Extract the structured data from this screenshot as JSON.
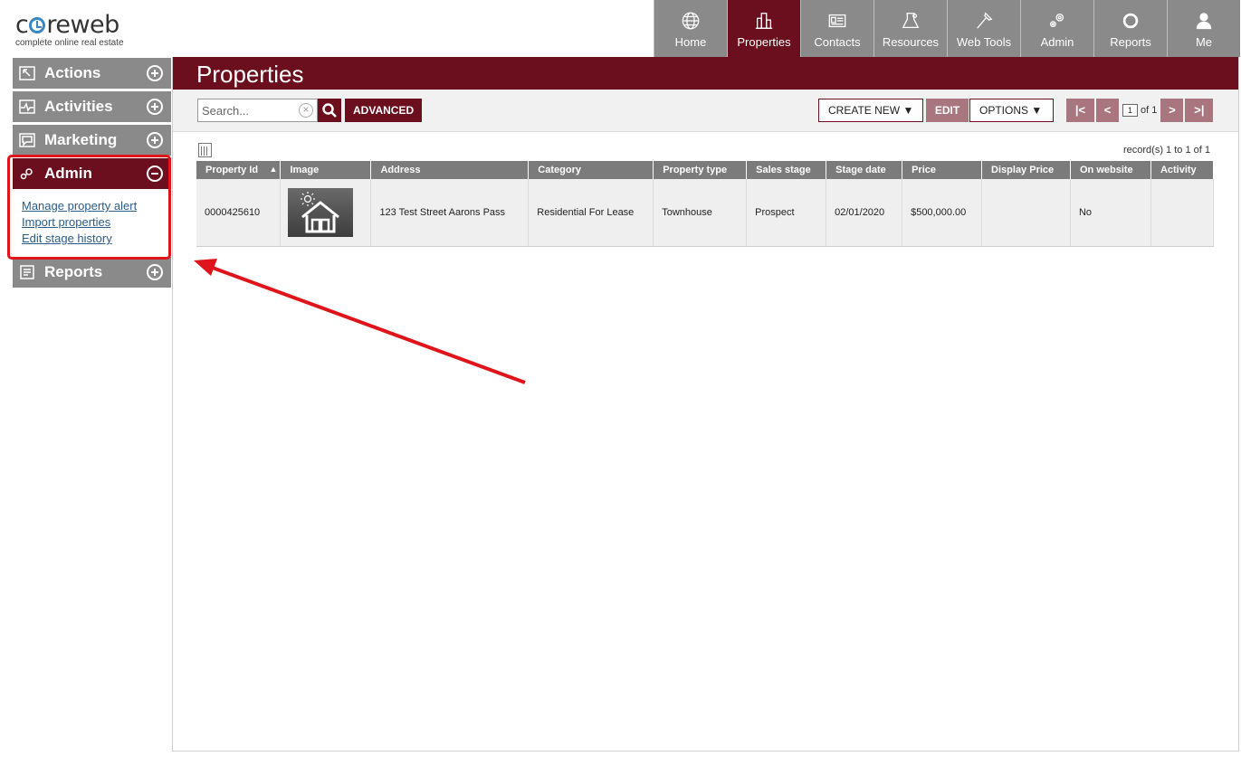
{
  "brand": {
    "name": "coreweb",
    "name_prefix": "c",
    "name_suffix": "reweb",
    "tagline": "complete online real estate"
  },
  "topnav": [
    {
      "label": "Home",
      "icon": "globe-icon",
      "active": false
    },
    {
      "label": "Properties",
      "icon": "buildings-icon",
      "active": true
    },
    {
      "label": "Contacts",
      "icon": "contact-card-icon",
      "active": false
    },
    {
      "label": "Resources",
      "icon": "lab-flask-icon",
      "active": false
    },
    {
      "label": "Web Tools",
      "icon": "hammer-icon",
      "active": false
    },
    {
      "label": "Admin",
      "icon": "gears-icon",
      "active": false
    },
    {
      "label": "Reports",
      "icon": "lifebuoy-icon",
      "active": false
    },
    {
      "label": "Me",
      "icon": "user-icon",
      "active": false
    }
  ],
  "sidebar": {
    "sections": [
      {
        "label": "Actions",
        "icon": "actions-icon",
        "expanded": false
      },
      {
        "label": "Activities",
        "icon": "activity-pulse-icon",
        "expanded": false
      },
      {
        "label": "Marketing",
        "icon": "chat-bubble-icon",
        "expanded": false
      },
      {
        "label": "Admin",
        "icon": "key-icon",
        "expanded": true
      },
      {
        "label": "Reports",
        "icon": "document-icon",
        "expanded": false
      }
    ],
    "admin_links": [
      "Manage property alert",
      "Import properties",
      "Edit stage history"
    ]
  },
  "page": {
    "title": "Properties"
  },
  "toolbar": {
    "search_placeholder": "Search...",
    "advanced_label": "ADVANCED",
    "create_new_label": "CREATE NEW",
    "edit_label": "EDIT",
    "options_label": "OPTIONS",
    "pager": {
      "first": "|<",
      "prev": "<",
      "current_page": "1",
      "of_text": "of 1",
      "next": ">",
      "last": ">|"
    }
  },
  "records_text": "record(s) 1 to 1 of 1",
  "table": {
    "columns": [
      "Property Id",
      "Image",
      "Address",
      "Category",
      "Property type",
      "Sales stage",
      "Stage date",
      "Price",
      "Display Price",
      "On website",
      "Activity"
    ],
    "sort_indicator": "▲",
    "rows": [
      {
        "property_id": "0000425610",
        "image": "house-placeholder-icon",
        "address": "123 Test Street Aarons Pass",
        "category": "Residential For Lease",
        "property_type": "Townhouse",
        "sales_stage": "Prospect",
        "stage_date": "02/01/2020",
        "price": "$500,000.00",
        "display_price": "",
        "on_website": "No",
        "activity": ""
      }
    ]
  },
  "colors": {
    "brand": "#6b0f1e",
    "nav_gray": "#8a8a8a",
    "highlight": "#e0151b",
    "link": "#2b5b8a"
  }
}
